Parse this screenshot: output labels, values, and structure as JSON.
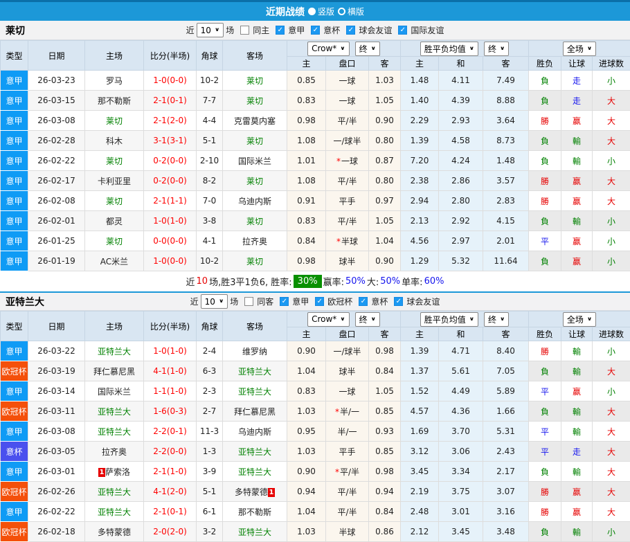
{
  "banner": {
    "title": "近期战绩",
    "vertical_label": "竖版",
    "horizontal_label": "横版"
  },
  "table_header": {
    "cols": [
      "类型",
      "日期",
      "主场",
      "比分(半场)",
      "角球",
      "客场"
    ],
    "sub": [
      "主",
      "盘口",
      "客",
      "主",
      "和",
      "客",
      "胜负",
      "让球",
      "进球数"
    ],
    "dd_crow": "Crow*",
    "dd_end": "终",
    "dd_mean": "胜平负均值",
    "dd_full": "全场"
  },
  "filter_labels": {
    "near": "近",
    "games": "场"
  },
  "league_colors": {
    "意甲": "#0F9BF5",
    "欧冠杯": "#F4500A",
    "意杯": "#4A50EE"
  },
  "result_colors": {
    "勝": "redtx",
    "平": "bluetx",
    "負": "green",
    "赢": "redtx",
    "走": "bluetx",
    "輸": "green",
    "大": "redtx",
    "小": "green"
  },
  "sections": [
    {
      "team": "莱切",
      "filter": {
        "count": "10",
        "same": "同主",
        "same_checked": false,
        "leagues": [
          "意甲",
          "意杯",
          "球会友谊",
          "国际友谊"
        ]
      },
      "rows": [
        {
          "lg": "意甲",
          "date": "26-03-23",
          "home": "罗马",
          "hg": false,
          "hcard": false,
          "score": "1-0",
          "half": "(0-0)",
          "cor": "10-2",
          "away": "莱切",
          "ag": true,
          "acard": false,
          "w1": "0.85",
          "pan": "一球",
          "star": false,
          "w2": "1.03",
          "m1": "1.48",
          "m2": "4.11",
          "m3": "7.49",
          "r": [
            "負",
            "走",
            "小"
          ]
        },
        {
          "lg": "意甲",
          "date": "26-03-15",
          "home": "那不勒斯",
          "hg": false,
          "hcard": false,
          "score": "2-1",
          "half": "(0-1)",
          "cor": "7-7",
          "away": "莱切",
          "ag": true,
          "acard": false,
          "w1": "0.83",
          "pan": "一球",
          "star": false,
          "w2": "1.05",
          "m1": "1.40",
          "m2": "4.39",
          "m3": "8.88",
          "r": [
            "負",
            "走",
            "大"
          ]
        },
        {
          "lg": "意甲",
          "date": "26-03-08",
          "home": "莱切",
          "hg": true,
          "hcard": false,
          "score": "2-1",
          "half": "(2-0)",
          "cor": "4-4",
          "away": "克雷莫内塞",
          "ag": false,
          "acard": false,
          "w1": "0.98",
          "pan": "平/半",
          "star": false,
          "w2": "0.90",
          "m1": "2.29",
          "m2": "2.93",
          "m3": "3.64",
          "r": [
            "勝",
            "赢",
            "大"
          ]
        },
        {
          "lg": "意甲",
          "date": "26-02-28",
          "home": "科木",
          "hg": false,
          "hcard": false,
          "score": "3-1",
          "half": "(3-1)",
          "cor": "5-1",
          "away": "莱切",
          "ag": true,
          "acard": false,
          "w1": "1.08",
          "pan": "一/球半",
          "star": false,
          "w2": "0.80",
          "m1": "1.39",
          "m2": "4.58",
          "m3": "8.73",
          "r": [
            "負",
            "輸",
            "大"
          ]
        },
        {
          "lg": "意甲",
          "date": "26-02-22",
          "home": "莱切",
          "hg": true,
          "hcard": false,
          "score": "0-2",
          "half": "(0-0)",
          "cor": "2-10",
          "away": "国际米兰",
          "ag": false,
          "acard": false,
          "w1": "1.01",
          "pan": "一球",
          "star": true,
          "w2": "0.87",
          "m1": "7.20",
          "m2": "4.24",
          "m3": "1.48",
          "r": [
            "負",
            "輸",
            "小"
          ]
        },
        {
          "lg": "意甲",
          "date": "26-02-17",
          "home": "卡利亚里",
          "hg": false,
          "hcard": false,
          "score": "0-2",
          "half": "(0-0)",
          "cor": "8-2",
          "away": "莱切",
          "ag": true,
          "acard": false,
          "w1": "1.08",
          "pan": "平/半",
          "star": false,
          "w2": "0.80",
          "m1": "2.38",
          "m2": "2.86",
          "m3": "3.57",
          "r": [
            "勝",
            "赢",
            "大"
          ]
        },
        {
          "lg": "意甲",
          "date": "26-02-08",
          "home": "莱切",
          "hg": true,
          "hcard": false,
          "score": "2-1",
          "half": "(1-1)",
          "cor": "7-0",
          "away": "乌迪内斯",
          "ag": false,
          "acard": false,
          "w1": "0.91",
          "pan": "平手",
          "star": false,
          "w2": "0.97",
          "m1": "2.94",
          "m2": "2.80",
          "m3": "2.83",
          "r": [
            "勝",
            "赢",
            "大"
          ]
        },
        {
          "lg": "意甲",
          "date": "26-02-01",
          "home": "都灵",
          "hg": false,
          "hcard": false,
          "score": "1-0",
          "half": "(1-0)",
          "cor": "3-8",
          "away": "莱切",
          "ag": true,
          "acard": false,
          "w1": "0.83",
          "pan": "平/半",
          "star": false,
          "w2": "1.05",
          "m1": "2.13",
          "m2": "2.92",
          "m3": "4.15",
          "r": [
            "負",
            "輸",
            "小"
          ]
        },
        {
          "lg": "意甲",
          "date": "26-01-25",
          "home": "莱切",
          "hg": true,
          "hcard": false,
          "score": "0-0",
          "half": "(0-0)",
          "cor": "4-1",
          "away": "拉齐奥",
          "ag": false,
          "acard": false,
          "w1": "0.84",
          "pan": "半球",
          "star": true,
          "w2": "1.04",
          "m1": "4.56",
          "m2": "2.97",
          "m3": "2.01",
          "r": [
            "平",
            "赢",
            "小"
          ]
        },
        {
          "lg": "意甲",
          "date": "26-01-19",
          "home": "AC米兰",
          "hg": false,
          "hcard": false,
          "score": "1-0",
          "half": "(0-0)",
          "cor": "10-2",
          "away": "莱切",
          "ag": true,
          "acard": false,
          "w1": "0.98",
          "pan": "球半",
          "star": false,
          "w2": "0.90",
          "m1": "1.29",
          "m2": "5.32",
          "m3": "11.64",
          "r": [
            "負",
            "赢",
            "小"
          ]
        }
      ],
      "summary": [
        {
          "t": "近",
          "c": "black"
        },
        {
          "t": "10",
          "c": "red"
        },
        {
          "t": "场,胜3平1负6, 胜率:",
          "c": "black"
        },
        {
          "t": "30%",
          "c": "box"
        },
        {
          "t": "赢率:",
          "c": "black"
        },
        {
          "t": "50%",
          "c": "blue"
        },
        {
          "t": " 大:",
          "c": "black"
        },
        {
          "t": "50%",
          "c": "blue"
        },
        {
          "t": " 单率:",
          "c": "black"
        },
        {
          "t": "60%",
          "c": "blue"
        }
      ]
    },
    {
      "team": "亚特兰大",
      "filter": {
        "count": "10",
        "same": "同客",
        "same_checked": false,
        "leagues": [
          "意甲",
          "欧冠杯",
          "意杯",
          "球会友谊"
        ]
      },
      "rows": [
        {
          "lg": "意甲",
          "date": "26-03-22",
          "home": "亚特兰大",
          "hg": true,
          "hcard": false,
          "score": "1-0",
          "half": "(1-0)",
          "cor": "2-4",
          "away": "维罗纳",
          "ag": false,
          "acard": false,
          "w1": "0.90",
          "pan": "一/球半",
          "star": false,
          "w2": "0.98",
          "m1": "1.39",
          "m2": "4.71",
          "m3": "8.40",
          "r": [
            "勝",
            "輸",
            "小"
          ]
        },
        {
          "lg": "欧冠杯",
          "date": "26-03-19",
          "home": "拜仁慕尼黑",
          "hg": false,
          "hcard": false,
          "score": "4-1",
          "half": "(1-0)",
          "cor": "6-3",
          "away": "亚特兰大",
          "ag": true,
          "acard": false,
          "w1": "1.04",
          "pan": "球半",
          "star": false,
          "w2": "0.84",
          "m1": "1.37",
          "m2": "5.61",
          "m3": "7.05",
          "r": [
            "負",
            "輸",
            "大"
          ]
        },
        {
          "lg": "意甲",
          "date": "26-03-14",
          "home": "国际米兰",
          "hg": false,
          "hcard": false,
          "score": "1-1",
          "half": "(1-0)",
          "cor": "2-3",
          "away": "亚特兰大",
          "ag": true,
          "acard": false,
          "w1": "0.83",
          "pan": "一球",
          "star": false,
          "w2": "1.05",
          "m1": "1.52",
          "m2": "4.49",
          "m3": "5.89",
          "r": [
            "平",
            "赢",
            "小"
          ]
        },
        {
          "lg": "欧冠杯",
          "date": "26-03-11",
          "home": "亚特兰大",
          "hg": true,
          "hcard": false,
          "score": "1-6",
          "half": "(0-3)",
          "cor": "2-7",
          "away": "拜仁慕尼黑",
          "ag": false,
          "acard": false,
          "w1": "1.03",
          "pan": "半/一",
          "star": true,
          "w2": "0.85",
          "m1": "4.57",
          "m2": "4.36",
          "m3": "1.66",
          "r": [
            "負",
            "輸",
            "大"
          ]
        },
        {
          "lg": "意甲",
          "date": "26-03-08",
          "home": "亚特兰大",
          "hg": true,
          "hcard": false,
          "score": "2-2",
          "half": "(0-1)",
          "cor": "11-3",
          "away": "乌迪内斯",
          "ag": false,
          "acard": false,
          "w1": "0.95",
          "pan": "半/一",
          "star": false,
          "w2": "0.93",
          "m1": "1.69",
          "m2": "3.70",
          "m3": "5.31",
          "r": [
            "平",
            "輸",
            "大"
          ]
        },
        {
          "lg": "意杯",
          "date": "26-03-05",
          "home": "拉齐奥",
          "hg": false,
          "hcard": false,
          "score": "2-2",
          "half": "(0-0)",
          "cor": "1-3",
          "away": "亚特兰大",
          "ag": true,
          "acard": false,
          "w1": "1.03",
          "pan": "平手",
          "star": false,
          "w2": "0.85",
          "m1": "3.12",
          "m2": "3.06",
          "m3": "2.43",
          "r": [
            "平",
            "走",
            "大"
          ]
        },
        {
          "lg": "意甲",
          "date": "26-03-01",
          "home": "萨索洛",
          "hg": false,
          "hcard": true,
          "score": "2-1",
          "half": "(1-0)",
          "cor": "3-9",
          "away": "亚特兰大",
          "ag": true,
          "acard": false,
          "w1": "0.90",
          "pan": "平/半",
          "star": true,
          "w2": "0.98",
          "m1": "3.45",
          "m2": "3.34",
          "m3": "2.17",
          "r": [
            "負",
            "輸",
            "大"
          ]
        },
        {
          "lg": "欧冠杯",
          "date": "26-02-26",
          "home": "亚特兰大",
          "hg": true,
          "hcard": false,
          "score": "4-1",
          "half": "(2-0)",
          "cor": "5-1",
          "away": "多特蒙德",
          "ag": false,
          "acard": true,
          "w1": "0.94",
          "pan": "平/半",
          "star": false,
          "w2": "0.94",
          "m1": "2.19",
          "m2": "3.75",
          "m3": "3.07",
          "r": [
            "勝",
            "赢",
            "大"
          ]
        },
        {
          "lg": "意甲",
          "date": "26-02-22",
          "home": "亚特兰大",
          "hg": true,
          "hcard": false,
          "score": "2-1",
          "half": "(0-1)",
          "cor": "6-1",
          "away": "那不勒斯",
          "ag": false,
          "acard": false,
          "w1": "1.04",
          "pan": "平/半",
          "star": false,
          "w2": "0.84",
          "m1": "2.48",
          "m2": "3.01",
          "m3": "3.16",
          "r": [
            "勝",
            "赢",
            "大"
          ]
        },
        {
          "lg": "欧冠杯",
          "date": "26-02-18",
          "home": "多特蒙德",
          "hg": false,
          "hcard": false,
          "score": "2-0",
          "half": "(2-0)",
          "cor": "3-2",
          "away": "亚特兰大",
          "ag": true,
          "acard": false,
          "w1": "1.03",
          "pan": "半球",
          "star": false,
          "w2": "0.86",
          "m1": "2.12",
          "m2": "3.45",
          "m3": "3.48",
          "r": [
            "負",
            "輸",
            "小"
          ]
        }
      ],
      "summary": null
    }
  ]
}
